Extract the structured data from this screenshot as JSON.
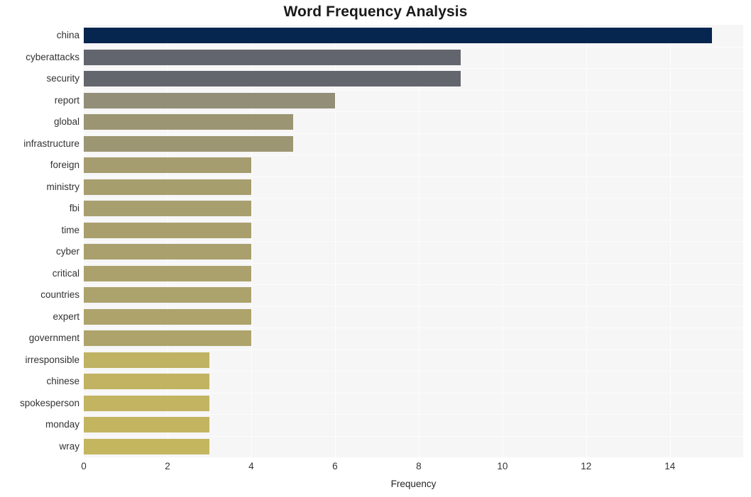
{
  "chart_data": {
    "type": "bar",
    "orientation": "horizontal",
    "title": "Word Frequency Analysis",
    "xlabel": "Frequency",
    "ylabel": "",
    "categories": [
      "china",
      "cyberattacks",
      "security",
      "report",
      "global",
      "infrastructure",
      "foreign",
      "ministry",
      "fbi",
      "time",
      "cyber",
      "critical",
      "countries",
      "expert",
      "government",
      "irresponsible",
      "chinese",
      "spokesperson",
      "monday",
      "wray"
    ],
    "values": [
      15,
      9,
      9,
      6,
      5,
      5,
      4,
      4,
      4,
      4,
      4,
      4,
      4,
      4,
      4,
      3,
      3,
      3,
      3,
      3
    ],
    "bar_colors": [
      "#06254f",
      "#62656e",
      "#64666e",
      "#928e78",
      "#9b9573",
      "#9c9673",
      "#a59c6f",
      "#a79e6e",
      "#a89f6e",
      "#a99f6d",
      "#aaa06d",
      "#aba16c",
      "#aca26c",
      "#ada36b",
      "#aea46b",
      "#c0b263",
      "#c1b362",
      "#c2b461",
      "#c3b560",
      "#c4b65f"
    ],
    "xlim": [
      0,
      15.75
    ],
    "xticks": [
      0,
      2,
      4,
      6,
      8,
      10,
      12,
      14
    ],
    "xtick_labels": [
      "0",
      "2",
      "4",
      "6",
      "8",
      "10",
      "12",
      "14"
    ],
    "grid": true,
    "grid_axis": "x",
    "legend": null,
    "plot_background": "#f6f6f7",
    "figure_background": "#ffffff"
  }
}
